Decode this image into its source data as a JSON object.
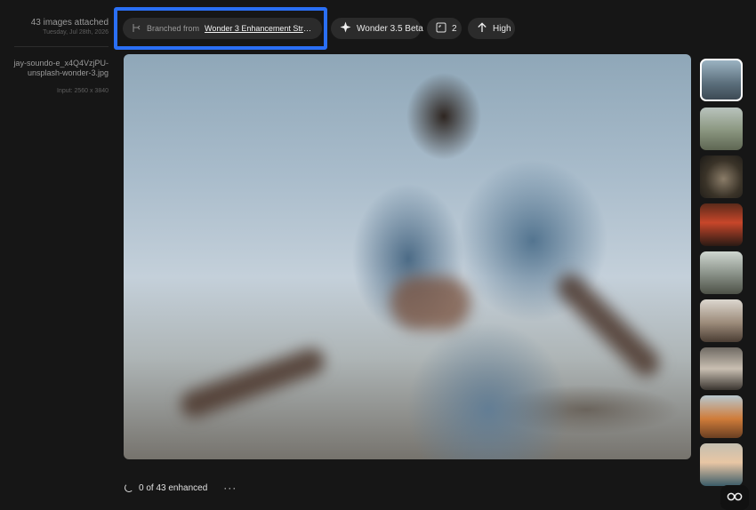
{
  "sidebar": {
    "images_attached": "43 images attached",
    "date": "Tuesday, Jul 28th, 2026",
    "filename": "jay-soundo-e_x4Q4VzjPU-unsplash-wonder-3.jpg",
    "input_size": "Input: 2560 x 3840"
  },
  "toolbar": {
    "branch_prefix": "Branched from",
    "branch_link": "Wonder 3 Enhancement Stren...",
    "model": "Wonder 3.5 Beta",
    "count": "2",
    "quality": "High"
  },
  "status": {
    "progress_text": "0 of 43 enhanced",
    "more_label": "···"
  },
  "colors": {
    "highlight": "#2a6ff5",
    "background": "#161616",
    "chip": "#2b2b2b"
  },
  "thumbnails": [
    {
      "name": "thumb-1",
      "selected": true
    },
    {
      "name": "thumb-2"
    },
    {
      "name": "thumb-3"
    },
    {
      "name": "thumb-4"
    },
    {
      "name": "thumb-5"
    },
    {
      "name": "thumb-6"
    },
    {
      "name": "thumb-7"
    },
    {
      "name": "thumb-8"
    },
    {
      "name": "thumb-9"
    }
  ]
}
